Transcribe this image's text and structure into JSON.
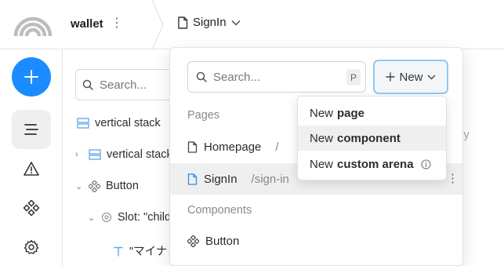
{
  "header": {
    "project_name": "wallet",
    "kebab": "⋮",
    "current_page": "SignIn"
  },
  "rail": {
    "icons": [
      "plus-icon",
      "layers-icon",
      "warning-icon",
      "components-icon",
      "settings-icon"
    ],
    "accent": "#1a8cff"
  },
  "tree": {
    "search_placeholder": "Search...",
    "rows": [
      {
        "label": "vertical stack"
      },
      {
        "label": "vertical stack"
      },
      {
        "label": "Button"
      },
      {
        "label": "Slot: \"children\""
      },
      {
        "label": "\"マイナンバー"
      }
    ],
    "faded": "ly"
  },
  "pages_panel": {
    "search_placeholder": "Search...",
    "shortcut": "P",
    "new_label": "New",
    "pages_section": "Pages",
    "pages": [
      {
        "label": "Homepage",
        "path": "/"
      },
      {
        "label": "SignIn",
        "path": "/sign-in"
      }
    ],
    "components_section": "Components",
    "components": [
      {
        "label": "Button"
      }
    ]
  },
  "new_menu": {
    "items": [
      {
        "prefix": "New",
        "bold": "page"
      },
      {
        "prefix": "New",
        "bold": "component"
      },
      {
        "prefix": "New",
        "bold": "custom arena"
      }
    ]
  }
}
